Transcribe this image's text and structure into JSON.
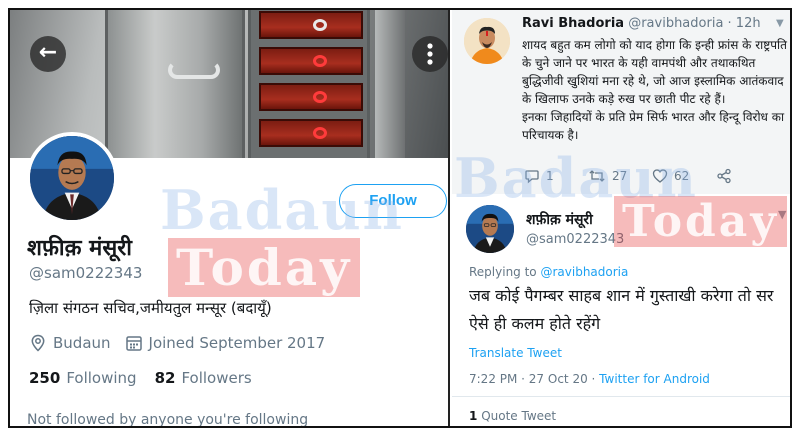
{
  "profile": {
    "name": "शफ़ीक़ मंसूरी",
    "handle": "@sam0222343",
    "bio": "ज़िला संगठन सचिव,जमीयतुल मन्सूर (बदायूँ)",
    "location": "Budaun",
    "joined": "Joined September 2017",
    "following_count": "250",
    "following_label": "Following",
    "followers_count": "82",
    "followers_label": "Followers",
    "not_followed": "Not followed by anyone you're following",
    "follow_button": "Follow",
    "back_icon": "arrow-left-icon",
    "more_icon": "more-vertical-icon"
  },
  "tweet1": {
    "name": "Ravi Bhadoria",
    "handle": "@ravibhadoria",
    "time": "· 12h",
    "body_1": "शायद बहुत कम लोगो को याद होगा कि इन्ही फ्रांस के राष्ट्रपति के चुने जाने पर भारत के यही वामपंथी और तथाकथित बुद्धिजीवी खुशियां मना रहे थे, जो आज इस्लामिक आतंकवाद के खिलाफ उनके कड़े रुख पर छाती पीट रहे हैं।",
    "body_2": "इनका जिहादियों के प्रति प्रेम सिर्फ भारत और हिन्दू विरोध का परिचायक है।",
    "replies": "1",
    "retweets": "27",
    "likes": "62"
  },
  "tweet2": {
    "name": "शफ़ीक़ मंसूरी",
    "handle": "@sam0222343",
    "replying_prefix": "Replying to",
    "replying_to": "@ravibhadoria",
    "body": "जब कोई पैगम्बर साहब शान में गुस्ताखी करेगा तो सर ऐसे ही कलम होते रहेंगे",
    "translate": "Translate Tweet",
    "timestamp": "7:22 PM · 27 Oct 20 ·",
    "source": "Twitter for Android",
    "quote_count": "1",
    "quote_label": "Quote Tweet"
  },
  "watermark": {
    "badaun": "Badaun",
    "today": "Today"
  },
  "colors": {
    "accent": "#1da1f2",
    "secondary_text": "#657786",
    "primary_text": "#14171a"
  }
}
